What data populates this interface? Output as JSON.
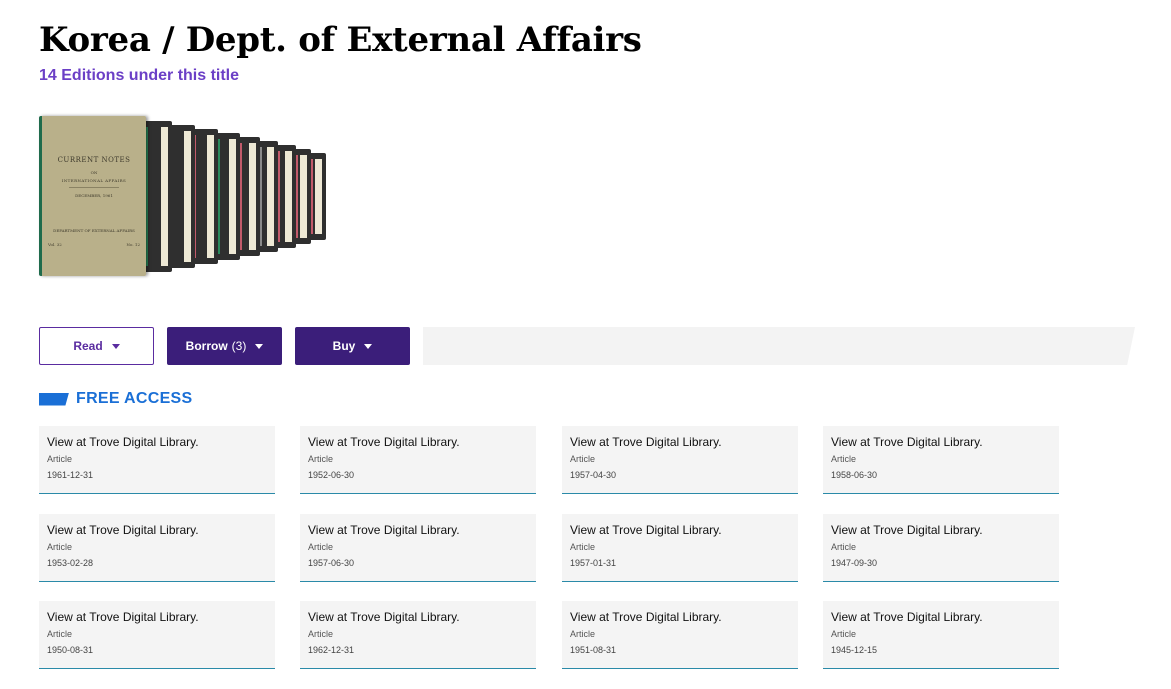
{
  "page": {
    "title": "Korea / Dept. of External Affairs",
    "editions": "14 Editions under this title"
  },
  "cover": {
    "line1": "CURRENT NOTES",
    "line2": "ON",
    "line3": "INTERNATIONAL AFFAIRS",
    "line4": "DECEMBER, 1961",
    "footer_left": "Vol. 32",
    "footer_right": "No. 12",
    "publisher": "DEPARTMENT OF EXTERNAL AFFAIRS"
  },
  "actions": {
    "read": "Read",
    "borrow": "Borrow",
    "borrow_count": "(3)",
    "buy": "Buy"
  },
  "section": {
    "label": "FREE ACCESS"
  },
  "cards": [
    {
      "title": "View at Trove Digital Library.",
      "type": "Article",
      "date": "1961-12-31"
    },
    {
      "title": "View at Trove Digital Library.",
      "type": "Article",
      "date": "1952-06-30"
    },
    {
      "title": "View at Trove Digital Library.",
      "type": "Article",
      "date": "1957-04-30"
    },
    {
      "title": "View at Trove Digital Library.",
      "type": "Article",
      "date": "1958-06-30"
    },
    {
      "title": "View at Trove Digital Library.",
      "type": "Article",
      "date": "1953-02-28"
    },
    {
      "title": "View at Trove Digital Library.",
      "type": "Article",
      "date": "1957-06-30"
    },
    {
      "title": "View at Trove Digital Library.",
      "type": "Article",
      "date": "1957-01-31"
    },
    {
      "title": "View at Trove Digital Library.",
      "type": "Article",
      "date": "1947-09-30"
    },
    {
      "title": "View at Trove Digital Library.",
      "type": "Article",
      "date": "1950-08-31"
    },
    {
      "title": "View at Trove Digital Library.",
      "type": "Article",
      "date": "1962-12-31"
    },
    {
      "title": "View at Trove Digital Library.",
      "type": "Article",
      "date": "1951-08-31"
    },
    {
      "title": "View at Trove Digital Library.",
      "type": "Article",
      "date": "1945-12-15"
    }
  ],
  "colors": {
    "accent_purple": "#3b1e7a",
    "editions_purple": "#6b3fc6",
    "free_access_blue": "#1a6fd6"
  }
}
